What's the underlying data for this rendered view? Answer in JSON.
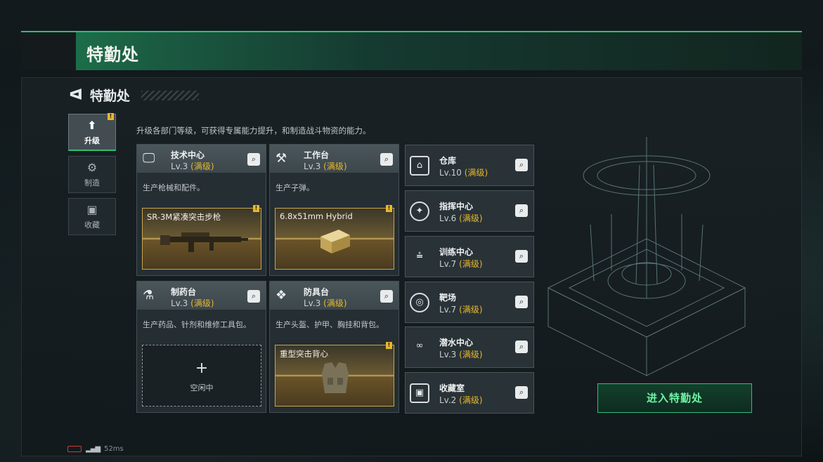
{
  "header": {
    "title": "特勤处"
  },
  "nav": {
    "back_label": "特勤处"
  },
  "description": "升级各部门等级，可获得专属能力提升，和制造战斗物资的能力。",
  "tabs": [
    {
      "label": "升级",
      "badge": "!"
    },
    {
      "label": "制造"
    },
    {
      "label": "收藏"
    }
  ],
  "departments": [
    {
      "name": "技术中心",
      "level": "Lv.3",
      "max": "(满级)",
      "desc": "生产枪械和配件。",
      "slot": "SR-3M紧凑突击步枪",
      "slot_badge": "!"
    },
    {
      "name": "工作台",
      "level": "Lv.3",
      "max": "(满级)",
      "desc": "生产子弹。",
      "slot": "6.8x51mm Hybrid",
      "slot_badge": "!"
    },
    {
      "name": "制药台",
      "level": "Lv.3",
      "max": "(满级)",
      "desc": "生产药品、针剂和维修工具包。",
      "slot_plus": "+",
      "slot": "空闲中"
    },
    {
      "name": "防具台",
      "level": "Lv.3",
      "max": "(满级)",
      "desc": "生产头盔、护甲、胸挂和背包。",
      "slot": "重型突击背心",
      "slot_badge": "!"
    }
  ],
  "facilities": [
    {
      "name": "仓库",
      "level": "Lv.10",
      "max": "(满级)"
    },
    {
      "name": "指挥中心",
      "level": "Lv.6",
      "max": "(满级)"
    },
    {
      "name": "训练中心",
      "level": "Lv.7",
      "max": "(满级)"
    },
    {
      "name": "靶场",
      "level": "Lv.7",
      "max": "(满级)"
    },
    {
      "name": "潜水中心",
      "level": "Lv.3",
      "max": "(满级)"
    },
    {
      "name": "收藏室",
      "level": "Lv.2",
      "max": "(满级)"
    }
  ],
  "enter_button": "进入特勤处",
  "status": {
    "ping": "52ms"
  },
  "colors": {
    "accent": "#2fbf74",
    "gold": "#e8b72c"
  }
}
